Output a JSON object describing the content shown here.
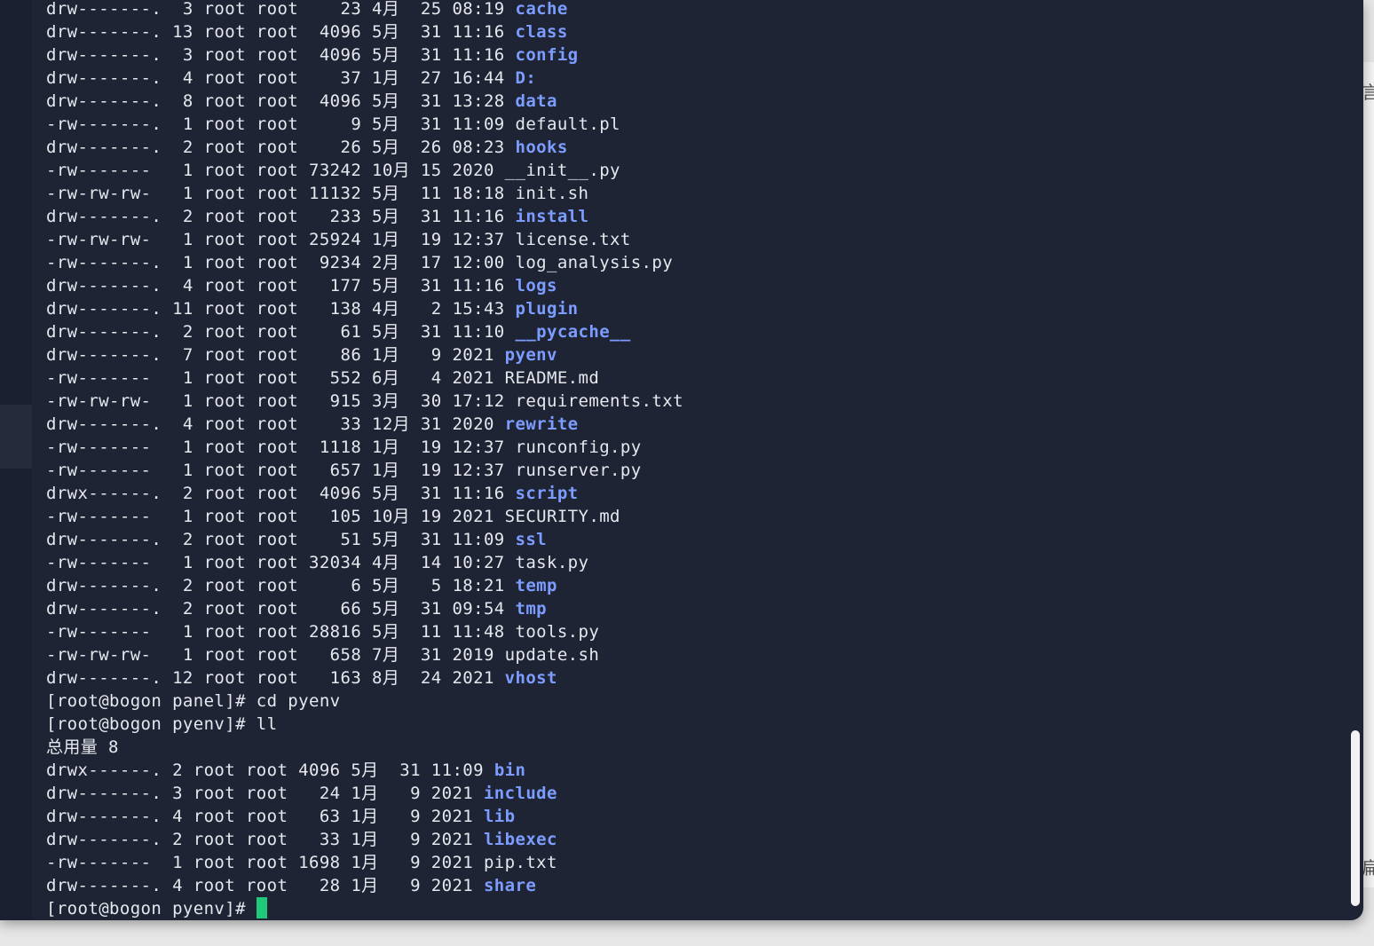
{
  "listing": [
    {
      "perm": "drw-------.",
      "links": " 3",
      "owner": "root",
      "group": "root",
      "size": "   23",
      "month": "4月",
      "day": "25",
      "time": "08:19",
      "name": "cache",
      "type": "dir"
    },
    {
      "perm": "drw-------.",
      "links": "13",
      "owner": "root",
      "group": "root",
      "size": " 4096",
      "month": "5月",
      "day": "31",
      "time": "11:16",
      "name": "class",
      "type": "dir"
    },
    {
      "perm": "drw-------.",
      "links": " 3",
      "owner": "root",
      "group": "root",
      "size": " 4096",
      "month": "5月",
      "day": "31",
      "time": "11:16",
      "name": "config",
      "type": "dir"
    },
    {
      "perm": "drw-------.",
      "links": " 4",
      "owner": "root",
      "group": "root",
      "size": "   37",
      "month": "1月",
      "day": "27",
      "time": "16:44",
      "name": "D:",
      "type": "dir"
    },
    {
      "perm": "drw-------.",
      "links": " 8",
      "owner": "root",
      "group": "root",
      "size": " 4096",
      "month": "5月",
      "day": "31",
      "time": "13:28",
      "name": "data",
      "type": "dir"
    },
    {
      "perm": "-rw-------.",
      "links": " 1",
      "owner": "root",
      "group": "root",
      "size": "    9",
      "month": "5月",
      "day": "31",
      "time": "11:09",
      "name": "default.pl",
      "type": "file"
    },
    {
      "perm": "drw-------.",
      "links": " 2",
      "owner": "root",
      "group": "root",
      "size": "   26",
      "month": "5月",
      "day": "26",
      "time": "08:23",
      "name": "hooks",
      "type": "dir"
    },
    {
      "perm": "-rw------- ",
      "links": " 1",
      "owner": "root",
      "group": "root",
      "size": "73242",
      "month": "10月",
      "day": "15",
      "time": "2020",
      "name": "__init__.py",
      "type": "file"
    },
    {
      "perm": "-rw-rw-rw- ",
      "links": " 1",
      "owner": "root",
      "group": "root",
      "size": "11132",
      "month": "5月",
      "day": "11",
      "time": "18:18",
      "name": "init.sh",
      "type": "file"
    },
    {
      "perm": "drw-------.",
      "links": " 2",
      "owner": "root",
      "group": "root",
      "size": "  233",
      "month": "5月",
      "day": "31",
      "time": "11:16",
      "name": "install",
      "type": "dir"
    },
    {
      "perm": "-rw-rw-rw- ",
      "links": " 1",
      "owner": "root",
      "group": "root",
      "size": "25924",
      "month": "1月",
      "day": "19",
      "time": "12:37",
      "name": "license.txt",
      "type": "file"
    },
    {
      "perm": "-rw-------.",
      "links": " 1",
      "owner": "root",
      "group": "root",
      "size": " 9234",
      "month": "2月",
      "day": "17",
      "time": "12:00",
      "name": "log_analysis.py",
      "type": "file"
    },
    {
      "perm": "drw-------.",
      "links": " 4",
      "owner": "root",
      "group": "root",
      "size": "  177",
      "month": "5月",
      "day": "31",
      "time": "11:16",
      "name": "logs",
      "type": "dir"
    },
    {
      "perm": "drw-------.",
      "links": "11",
      "owner": "root",
      "group": "root",
      "size": "  138",
      "month": "4月",
      "day": " 2",
      "time": "15:43",
      "name": "plugin",
      "type": "dir"
    },
    {
      "perm": "drw-------.",
      "links": " 2",
      "owner": "root",
      "group": "root",
      "size": "   61",
      "month": "5月",
      "day": "31",
      "time": "11:10",
      "name": "__pycache__",
      "type": "dir"
    },
    {
      "perm": "drw-------.",
      "links": " 7",
      "owner": "root",
      "group": "root",
      "size": "   86",
      "month": "1月",
      "day": " 9",
      "time": "2021",
      "name": "pyenv",
      "type": "dir"
    },
    {
      "perm": "-rw------- ",
      "links": " 1",
      "owner": "root",
      "group": "root",
      "size": "  552",
      "month": "6月",
      "day": " 4",
      "time": "2021",
      "name": "README.md",
      "type": "file"
    },
    {
      "perm": "-rw-rw-rw- ",
      "links": " 1",
      "owner": "root",
      "group": "root",
      "size": "  915",
      "month": "3月",
      "day": "30",
      "time": "17:12",
      "name": "requirements.txt",
      "type": "file"
    },
    {
      "perm": "drw-------.",
      "links": " 4",
      "owner": "root",
      "group": "root",
      "size": "   33",
      "month": "12月",
      "day": "31",
      "time": "2020",
      "name": "rewrite",
      "type": "dir"
    },
    {
      "perm": "-rw------- ",
      "links": " 1",
      "owner": "root",
      "group": "root",
      "size": " 1118",
      "month": "1月",
      "day": "19",
      "time": "12:37",
      "name": "runconfig.py",
      "type": "file"
    },
    {
      "perm": "-rw------- ",
      "links": " 1",
      "owner": "root",
      "group": "root",
      "size": "  657",
      "month": "1月",
      "day": "19",
      "time": "12:37",
      "name": "runserver.py",
      "type": "file"
    },
    {
      "perm": "drwx------.",
      "links": " 2",
      "owner": "root",
      "group": "root",
      "size": " 4096",
      "month": "5月",
      "day": "31",
      "time": "11:16",
      "name": "script",
      "type": "dir"
    },
    {
      "perm": "-rw------- ",
      "links": " 1",
      "owner": "root",
      "group": "root",
      "size": "  105",
      "month": "10月",
      "day": "19",
      "time": "2021",
      "name": "SECURITY.md",
      "type": "file"
    },
    {
      "perm": "drw-------.",
      "links": " 2",
      "owner": "root",
      "group": "root",
      "size": "   51",
      "month": "5月",
      "day": "31",
      "time": "11:09",
      "name": "ssl",
      "type": "dir"
    },
    {
      "perm": "-rw------- ",
      "links": " 1",
      "owner": "root",
      "group": "root",
      "size": "32034",
      "month": "4月",
      "day": "14",
      "time": "10:27",
      "name": "task.py",
      "type": "file"
    },
    {
      "perm": "drw-------.",
      "links": " 2",
      "owner": "root",
      "group": "root",
      "size": "    6",
      "month": "5月",
      "day": " 5",
      "time": "18:21",
      "name": "temp",
      "type": "dir"
    },
    {
      "perm": "drw-------.",
      "links": " 2",
      "owner": "root",
      "group": "root",
      "size": "   66",
      "month": "5月",
      "day": "31",
      "time": "09:54",
      "name": "tmp",
      "type": "dir"
    },
    {
      "perm": "-rw------- ",
      "links": " 1",
      "owner": "root",
      "group": "root",
      "size": "28816",
      "month": "5月",
      "day": "11",
      "time": "11:48",
      "name": "tools.py",
      "type": "file"
    },
    {
      "perm": "-rw-rw-rw- ",
      "links": " 1",
      "owner": "root",
      "group": "root",
      "size": "  658",
      "month": "7月",
      "day": "31",
      "time": "2019",
      "name": "update.sh",
      "type": "file"
    },
    {
      "perm": "drw-------.",
      "links": "12",
      "owner": "root",
      "group": "root",
      "size": "  163",
      "month": "8月",
      "day": "24",
      "time": "2021",
      "name": "vhost",
      "type": "dir"
    }
  ],
  "commands": [
    {
      "prompt": "[root@bogon panel]# ",
      "command": "cd pyenv"
    },
    {
      "prompt": "[root@bogon pyenv]# ",
      "command": "ll"
    }
  ],
  "total_line": "总用量 8",
  "listing2": [
    {
      "perm": "drwx------.",
      "links": "2",
      "owner": "root",
      "group": "root",
      "size": "4096",
      "month": "5月",
      "day": "31",
      "time": "11:09",
      "name": "bin",
      "type": "dir"
    },
    {
      "perm": "drw-------.",
      "links": "3",
      "owner": "root",
      "group": "root",
      "size": "  24",
      "month": "1月",
      "day": " 9",
      "time": "2021",
      "name": "include",
      "type": "dir"
    },
    {
      "perm": "drw-------.",
      "links": "4",
      "owner": "root",
      "group": "root",
      "size": "  63",
      "month": "1月",
      "day": " 9",
      "time": "2021",
      "name": "lib",
      "type": "dir"
    },
    {
      "perm": "drw-------.",
      "links": "2",
      "owner": "root",
      "group": "root",
      "size": "  33",
      "month": "1月",
      "day": " 9",
      "time": "2021",
      "name": "libexec",
      "type": "dir"
    },
    {
      "perm": "-rw------- ",
      "links": "1",
      "owner": "root",
      "group": "root",
      "size": "1698",
      "month": "1月",
      "day": " 9",
      "time": "2021",
      "name": "pip.txt",
      "type": "file"
    },
    {
      "perm": "drw-------.",
      "links": "4",
      "owner": "root",
      "group": "root",
      "size": "  28",
      "month": "1月",
      "day": " 9",
      "time": "2021",
      "name": "share",
      "type": "dir"
    }
  ],
  "final_prompt": "[root@bogon pyenv]# ",
  "colors": {
    "background": "#1e2434",
    "text": "#e6e8ee",
    "directory": "#7c9cff",
    "cursor": "#1ec97a"
  },
  "background_window_glyphs": [
    "言",
    "扁"
  ]
}
